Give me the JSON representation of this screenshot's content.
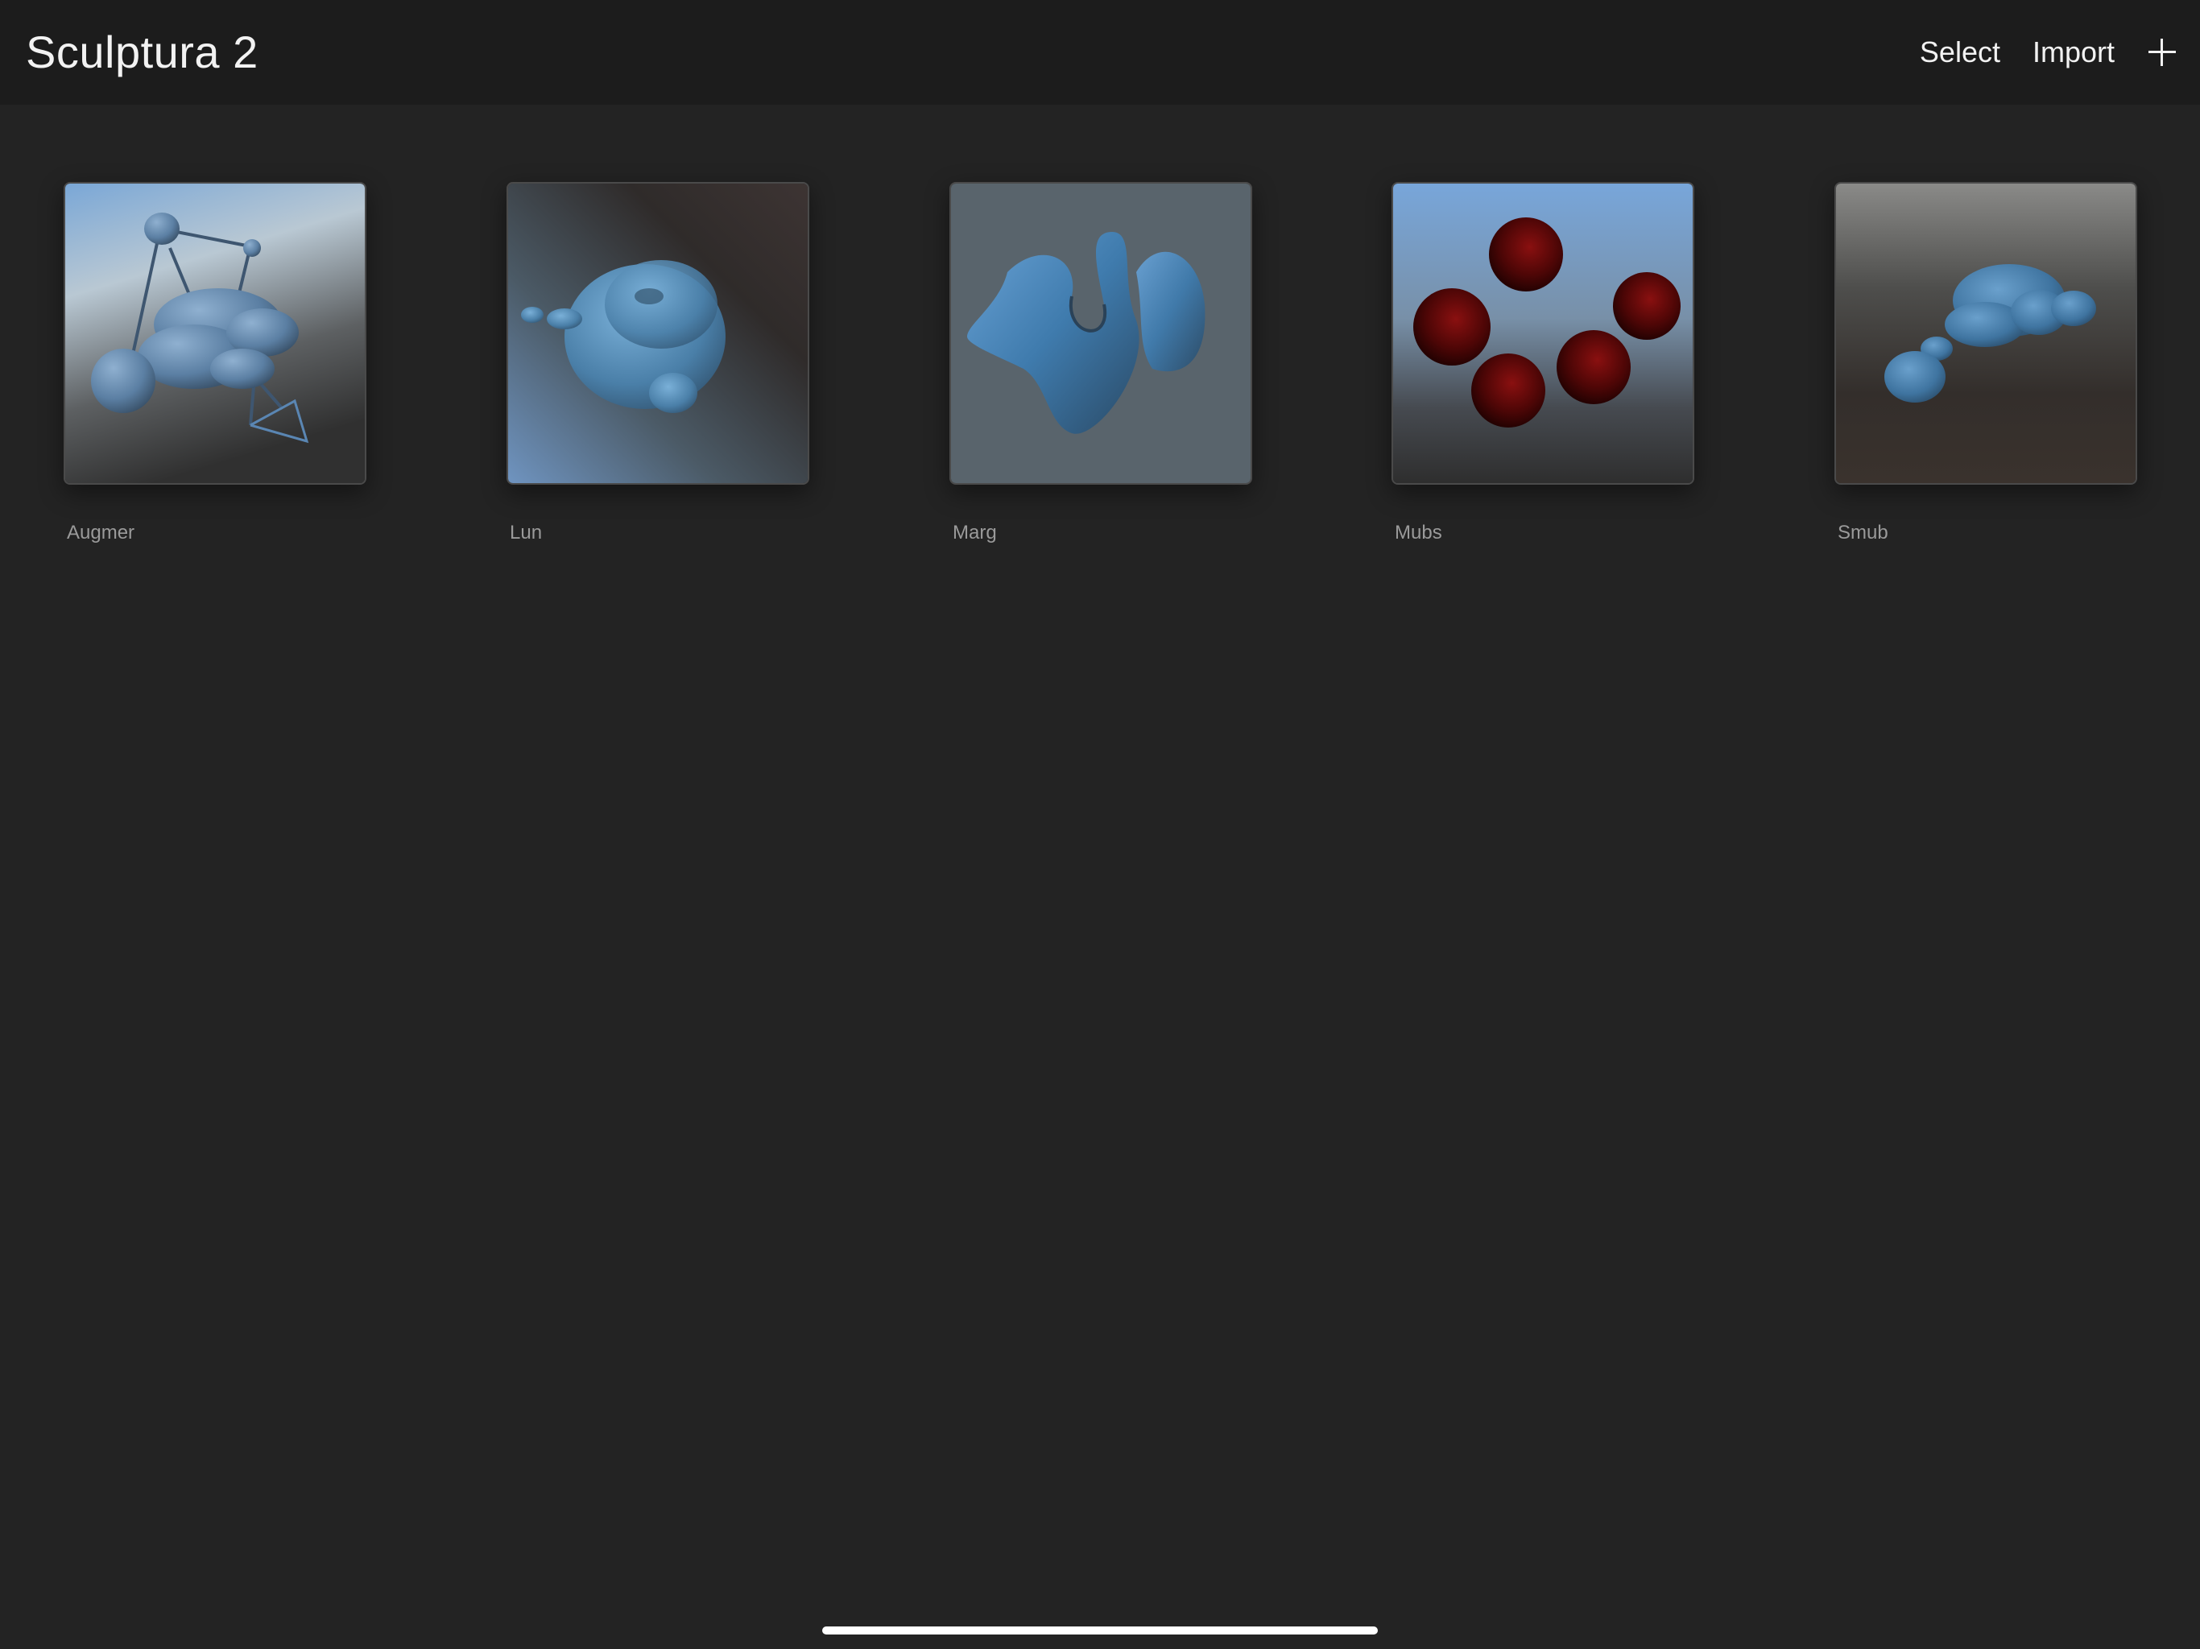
{
  "header": {
    "title": "Sculptura 2",
    "select_label": "Select",
    "import_label": "Import",
    "add_icon": "plus-icon"
  },
  "projects": [
    {
      "name": "Augmer"
    },
    {
      "name": "Lun"
    },
    {
      "name": "Marg"
    },
    {
      "name": "Mubs"
    },
    {
      "name": "Smub"
    }
  ],
  "colors": {
    "background": "#232323",
    "topbar": "#1c1c1c",
    "text_primary": "#f2f2f2",
    "text_secondary": "#9a9a9a",
    "sculpt_blue": "#4f7fa8",
    "sphere_red": "#5a0a0a"
  }
}
